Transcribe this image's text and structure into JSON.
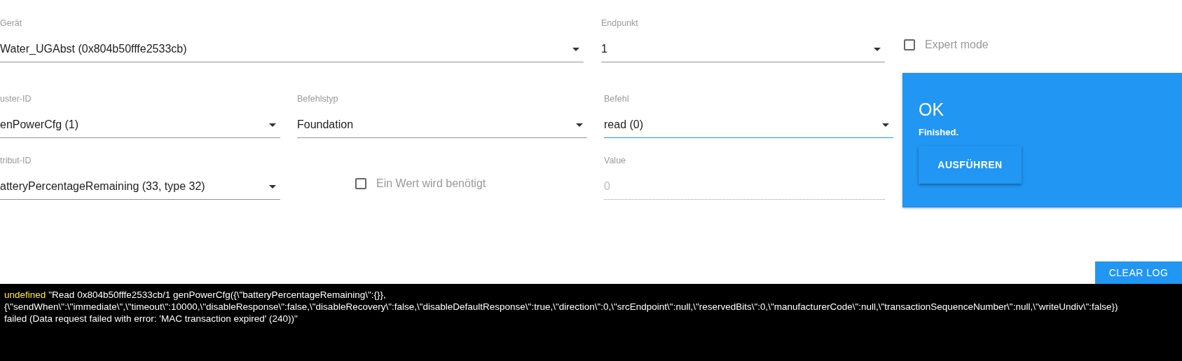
{
  "fields": [
    {
      "label": "Gerät",
      "value": "Water_UGAbst (0x804b50fffe2533cb)",
      "kind": "select",
      "focused": false,
      "disabled": false
    },
    {
      "label": "Endpunkt",
      "value": "1",
      "kind": "select",
      "focused": false,
      "disabled": false
    },
    {
      "label": "uster-ID",
      "value": "enPowerCfg (1)",
      "kind": "select",
      "focused": false,
      "disabled": false
    },
    {
      "label": "Befehlstyp",
      "value": "Foundation",
      "kind": "select",
      "focused": false,
      "disabled": false
    },
    {
      "label": "Befehl",
      "value": "read (0)",
      "kind": "select",
      "focused": true,
      "disabled": false
    },
    {
      "label": "tribut-ID",
      "value": "atteryPercentageRemaining (33, type 32)",
      "kind": "select",
      "focused": false,
      "disabled": false
    },
    {
      "label": "Value",
      "value": "0",
      "kind": "text",
      "focused": false,
      "disabled": true
    }
  ],
  "expert_mode": {
    "label": "Expert mode",
    "checked": false
  },
  "value_required": {
    "label": "Ein Wert wird benötigt",
    "checked": false
  },
  "status_card": {
    "title": "OK",
    "message": "Finished.",
    "button": "AUSFÜHREN"
  },
  "clear_log_button": "CLEAR LOG",
  "log": {
    "source": "undefined",
    "lines": [
      "\"Read 0x804b50fffe2533cb/1 genPowerCfg({\\\"batteryPercentageRemaining\\\":{}},",
      "{\\\"sendWhen\\\":\\\"immediate\\\",\\\"timeout\\\":10000,\\\"disableResponse\\\":false,\\\"disableRecovery\\\":false,\\\"disableDefaultResponse\\\":true,\\\"direction\\\":0,\\\"srcEndpoint\\\":null,\\\"reservedBits\\\":0,\\\"manufacturerCode\\\":null,\\\"transactionSequenceNumber\\\":null,\\\"writeUndiv\\\":false})",
      "failed (Data request failed with error: 'MAC transaction expired' (240))\""
    ]
  }
}
